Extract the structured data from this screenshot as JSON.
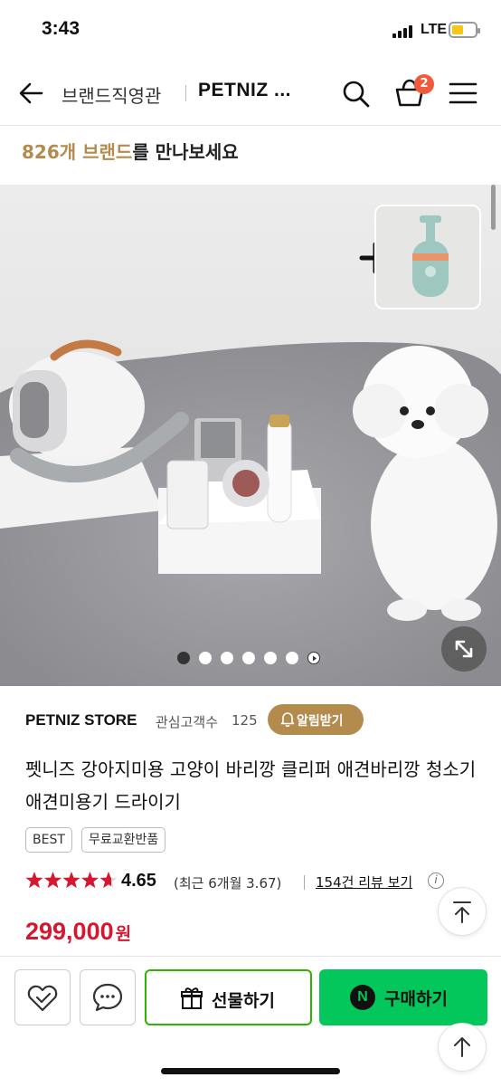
{
  "status_bar": {
    "time": "3:43",
    "network": "LTE"
  },
  "nav": {
    "brand_link": "브랜드직영관",
    "store_title": "PETNIZ ...",
    "cart_count": "2"
  },
  "promo": {
    "highlight": "826개 브랜드",
    "rest": "를 만나보세요"
  },
  "gallery": {
    "image_count": 6,
    "active_index": 0
  },
  "store": {
    "name": "PETNIZ STORE",
    "followers_label": "관심고객수",
    "followers_count": "125",
    "notify_label": "알림받기"
  },
  "product": {
    "title": "펫니즈 강아지미용 고양이 바리깡 클리퍼 애견바리깡 청소기 애견미용기 드라이기",
    "tags": [
      "BEST",
      "무료교환반품"
    ],
    "rating": "4.65",
    "rating_stars": 4.65,
    "recent_rating": "(최근 6개월 3.67)",
    "review_link": "154건 리뷰 보기",
    "price": "299,000",
    "price_unit": "원"
  },
  "bottom_bar": {
    "gift_label": "선물하기",
    "buy_label": "구매하기",
    "naver_mark": "N"
  },
  "colors": {
    "brand_gold": "#b38b4d",
    "price_red": "#d3182f",
    "naver_green": "#03c75a",
    "badge_orange": "#ef5a3a"
  }
}
